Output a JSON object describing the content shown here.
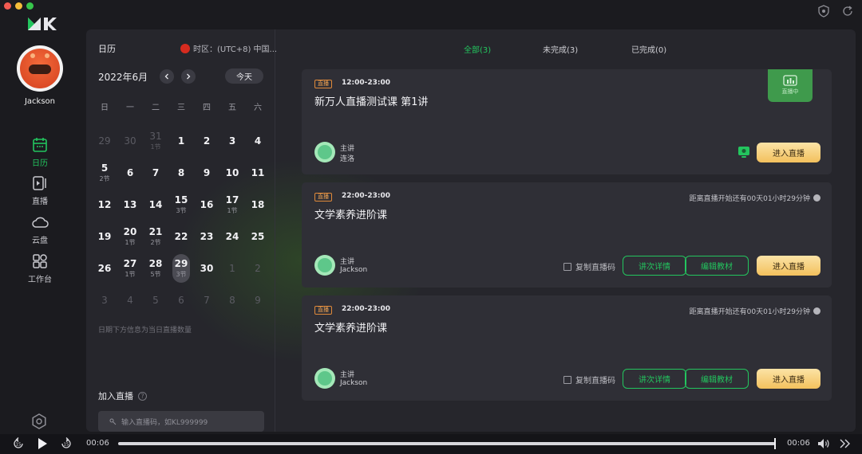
{
  "app": {
    "user_name": "Jackson",
    "accent_color": "#23c55e"
  },
  "nav": {
    "items": [
      {
        "label": "日历",
        "icon": "calendar-icon",
        "active": true
      },
      {
        "label": "直播",
        "icon": "live-icon",
        "active": false
      },
      {
        "label": "云盘",
        "icon": "cloud-icon",
        "active": false
      },
      {
        "label": "工作台",
        "icon": "workbench-icon",
        "active": false
      }
    ],
    "settings_icon": "settings-icon"
  },
  "calendar": {
    "title": "日历",
    "timezone": "时区：(UTC+8) 中国...",
    "month": "2022年6月",
    "today_button": "今天",
    "weekdays": [
      "日",
      "一",
      "二",
      "三",
      "四",
      "五",
      "六"
    ],
    "days": [
      {
        "d": "29",
        "sub": "",
        "other": true
      },
      {
        "d": "30",
        "sub": "",
        "other": true
      },
      {
        "d": "31",
        "sub": "1节",
        "other": true
      },
      {
        "d": "1",
        "sub": ""
      },
      {
        "d": "2",
        "sub": ""
      },
      {
        "d": "3",
        "sub": ""
      },
      {
        "d": "4",
        "sub": ""
      },
      {
        "d": "5",
        "sub": "2节"
      },
      {
        "d": "6",
        "sub": ""
      },
      {
        "d": "7",
        "sub": ""
      },
      {
        "d": "8",
        "sub": ""
      },
      {
        "d": "9",
        "sub": ""
      },
      {
        "d": "10",
        "sub": ""
      },
      {
        "d": "11",
        "sub": ""
      },
      {
        "d": "12",
        "sub": ""
      },
      {
        "d": "13",
        "sub": ""
      },
      {
        "d": "14",
        "sub": ""
      },
      {
        "d": "15",
        "sub": "3节"
      },
      {
        "d": "16",
        "sub": ""
      },
      {
        "d": "17",
        "sub": "1节"
      },
      {
        "d": "18",
        "sub": ""
      },
      {
        "d": "19",
        "sub": ""
      },
      {
        "d": "20",
        "sub": "1节"
      },
      {
        "d": "21",
        "sub": "2节"
      },
      {
        "d": "22",
        "sub": ""
      },
      {
        "d": "23",
        "sub": ""
      },
      {
        "d": "24",
        "sub": ""
      },
      {
        "d": "25",
        "sub": ""
      },
      {
        "d": "26",
        "sub": ""
      },
      {
        "d": "27",
        "sub": "1节"
      },
      {
        "d": "28",
        "sub": "5节"
      },
      {
        "d": "29",
        "sub": "3节",
        "selected": true
      },
      {
        "d": "30",
        "sub": ""
      },
      {
        "d": "1",
        "sub": "",
        "other": true
      },
      {
        "d": "2",
        "sub": "",
        "other": true
      },
      {
        "d": "3",
        "sub": "",
        "other": true
      },
      {
        "d": "4",
        "sub": "",
        "other": true
      },
      {
        "d": "5",
        "sub": "",
        "other": true
      },
      {
        "d": "6",
        "sub": "",
        "other": true
      },
      {
        "d": "7",
        "sub": "",
        "other": true
      },
      {
        "d": "8",
        "sub": "",
        "other": true
      },
      {
        "d": "9",
        "sub": "",
        "other": true
      }
    ],
    "hint": "日期下方信息为当日直播数量",
    "join_title": "加入直播",
    "join_help": "?",
    "join_placeholder": "输入直播码，如KL999999"
  },
  "tabs": [
    {
      "label": "全部(3)",
      "active": true
    },
    {
      "label": "未完成(3)",
      "active": false
    },
    {
      "label": "已完成(0)",
      "active": false
    }
  ],
  "sessions": [
    {
      "badge": "直播",
      "time": "12:00-23:00",
      "title": "新万人直播测试课 第1讲",
      "status_tag": "直播中",
      "role": "主讲",
      "teacher": "连洛",
      "enter_label": "进入直播"
    },
    {
      "badge": "直播",
      "time": "22:00-23:00",
      "title": "文学素养进阶课",
      "countdown": "距离直播开始还有00天01小时29分钟",
      "role": "主讲",
      "teacher": "Jackson",
      "copy_label": "复制直播码",
      "detail_label": "讲次详情",
      "edit_label": "编辑教材",
      "enter_label": "进入直播"
    },
    {
      "badge": "直播",
      "time": "22:00-23:00",
      "title": "文学素养进阶课",
      "countdown": "距离直播开始还有00天01小时29分钟",
      "role": "主讲",
      "teacher": "Jackson",
      "copy_label": "复制直播码",
      "detail_label": "讲次详情",
      "edit_label": "编辑教材",
      "enter_label": "进入直播"
    }
  ],
  "player": {
    "current_time": "00:06",
    "total_time": "00:06",
    "skip_back_label": "15",
    "skip_forward_label": "15",
    "progress": 1.0
  }
}
